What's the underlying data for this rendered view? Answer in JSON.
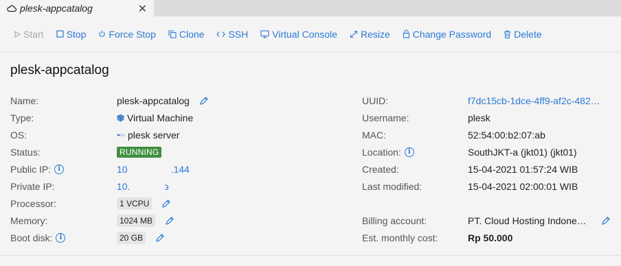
{
  "tab": {
    "label": "plesk-appcatalog",
    "close": "✕"
  },
  "toolbar": {
    "start": "Start",
    "stop": "Stop",
    "force_stop": "Force Stop",
    "clone": "Clone",
    "ssh": "SSH",
    "virtual_console": "Virtual Console",
    "resize": "Resize",
    "change_password": "Change Password",
    "delete": "Delete"
  },
  "page_title": "plesk-appcatalog",
  "left": {
    "name_label": "Name:",
    "name_value": "plesk-appcatalog",
    "type_label": "Type:",
    "type_value": "Virtual Machine",
    "os_label": "OS:",
    "os_value": "plesk server",
    "status_label": "Status:",
    "status_value": "RUNNING",
    "public_ip_label": "Public IP:",
    "public_ip_value_a": "10",
    "public_ip_value_b": ".144",
    "private_ip_label": "Private IP:",
    "private_ip_value_a": "10.",
    "private_ip_value_b": "϶",
    "processor_label": "Processor:",
    "processor_value": "1 VCPU",
    "memory_label": "Memory:",
    "memory_value": "1024 MB",
    "boot_disk_label": "Boot disk:",
    "boot_disk_value": "20 GB"
  },
  "right": {
    "uuid_label": "UUID:",
    "uuid_value": "f7dc15cb-1dce-4ff9-af2c-482…",
    "username_label": "Username:",
    "username_value": "plesk",
    "mac_label": "MAC:",
    "mac_value": "52:54:00:b2:07:ab",
    "location_label": "Location:",
    "location_value": "SouthJKT-a (jkt01) (jkt01)",
    "created_label": "Created:",
    "created_value": "15-04-2021 01:57:24 WIB",
    "modified_label": "Last modified:",
    "modified_value": "15-04-2021 02:00:01 WIB",
    "billing_label": "Billing account:",
    "billing_value": "PT. Cloud Hosting Indone…",
    "cost_label": "Est. monthly cost:",
    "cost_value": "Rp 50.000"
  },
  "colors": {
    "link": "#2a7ad6",
    "running": "#3f8f3f"
  }
}
